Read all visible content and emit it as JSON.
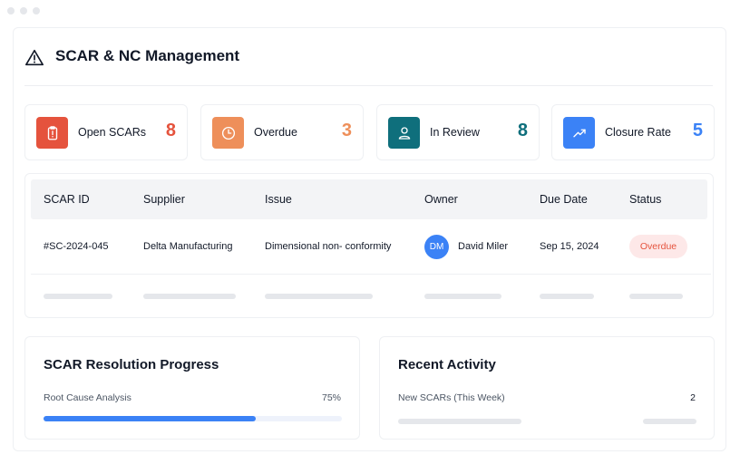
{
  "header": {
    "title": "SCAR & NC Management",
    "icon": "warning-icon"
  },
  "stats": [
    {
      "label": "Open SCARs",
      "value": "8",
      "icon": "clipboard-alert-icon",
      "color": "#e5533d",
      "value_color": "#e5533d"
    },
    {
      "label": "Overdue",
      "value": "3",
      "icon": "clock-icon",
      "color": "#ee8f5a",
      "value_color": "#ee8f5a"
    },
    {
      "label": "In Review",
      "value": "8",
      "icon": "user-icon",
      "color": "#0f6f7c",
      "value_color": "#0f6f7c"
    },
    {
      "label": "Closure Rate",
      "value": "5",
      "icon": "trending-up-icon",
      "color": "#3b82f6",
      "value_color": "#3b82f6"
    }
  ],
  "table": {
    "columns": [
      "SCAR ID",
      "Supplier",
      "Issue",
      "Owner",
      "Due Date",
      "Status"
    ],
    "rows": [
      {
        "scar_id": "#SC-2024-045",
        "supplier": "Delta Manufacturing",
        "issue": "Dimensional non- conformity",
        "owner_initials": "DM",
        "owner_name": "David Miler",
        "due_date": "Sep 15, 2024",
        "status": "Overdue"
      }
    ]
  },
  "progress_card": {
    "title": "SCAR Resolution Progress",
    "item_label": "Root Cause Analysis",
    "item_value": "75%",
    "fraction": 0.71
  },
  "activity_card": {
    "title": "Recent Activity",
    "item_label": "New SCARs (This Week)",
    "item_value": "2"
  },
  "colors": {
    "accent": "#3b82f6",
    "danger": "#e5533d",
    "danger_bg": "#fde8e8"
  }
}
